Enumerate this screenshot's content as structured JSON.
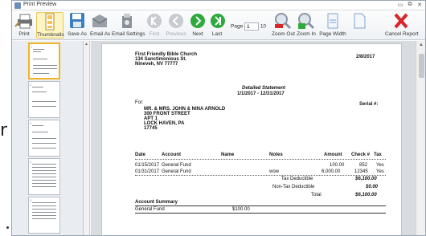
{
  "window": {
    "title": "Print Preview",
    "controls": [
      "▭",
      "⧉",
      "✕"
    ]
  },
  "backdrop": {
    "glyph": "r"
  },
  "toolbar": {
    "buttons": [
      {
        "label": "Print",
        "icon": "printer-icon"
      },
      {
        "label": "Thumbnails",
        "icon": "thumbnails-icon"
      },
      {
        "label": "Save As",
        "icon": "save-icon"
      },
      {
        "label": "Email As",
        "icon": "email-icon"
      },
      {
        "label": "Email Settings",
        "icon": "email-settings-icon"
      },
      {
        "label": "First",
        "icon": "first-page-icon"
      },
      {
        "label": "Previous",
        "icon": "previous-page-icon"
      },
      {
        "label": "Next",
        "icon": "next-page-icon"
      },
      {
        "label": "Last",
        "icon": "last-page-icon"
      },
      {
        "label": "Zoom Out",
        "icon": "zoom-out-icon"
      },
      {
        "label": "Zoom In",
        "icon": "zoom-in-icon"
      },
      {
        "label": "Page Width",
        "icon": "page-width-icon"
      },
      {
        "label": "",
        "icon": "page-icon"
      },
      {
        "label": "Cancel Report",
        "icon": "cancel-icon"
      }
    ],
    "page_label": "Page",
    "page_value": "1",
    "page_total": "10"
  },
  "thumbnails": {
    "numbers": [
      "1",
      "2",
      "3",
      "4",
      "5"
    ]
  },
  "report": {
    "church_name": "First Friendly Bible Church",
    "church_address1": "134 Sanctimonious St.",
    "church_address2": "Nineveh, NV 77777",
    "print_date": "2/8/2017",
    "statement_title": "Detailed Statement",
    "statement_range": "1/1/2017 - 12/31/2017",
    "for_label": "For:",
    "serial_label": "Serial #:",
    "recipient": [
      "MR. & MRS. JOHN & NINA ARNOLD",
      "300 FRONT STREET",
      "APT 1",
      "LOCK HAVEN, PA",
      "17745"
    ],
    "columns": {
      "date": "Date",
      "account": "Account",
      "name": "Name",
      "notes": "Notes",
      "amount": "Amount",
      "check": "Check #",
      "tax": "Tax"
    },
    "rows": [
      {
        "date": "01/15/2017",
        "account": "General Fund",
        "name": "",
        "notes": "",
        "amount": "100.00",
        "check": "852",
        "tax": "Yes"
      },
      {
        "date": "01/31/2017",
        "account": "General Fund",
        "name": "",
        "notes": "wow",
        "amount": "6,000.00",
        "check": "12345",
        "tax": "Yes"
      }
    ],
    "totals": [
      {
        "label": "Tax Deductible",
        "value": "$6,100.00"
      },
      {
        "label": "Non-Tax Deductible",
        "value": "$0.00"
      },
      {
        "label": "Total",
        "value": "$6,100.00"
      }
    ],
    "summary_title": "Account Summary",
    "summary_rows": [
      {
        "account": "General Fund",
        "amount": "$100.00"
      }
    ]
  },
  "colors": {
    "accent_selected": "#f0b429",
    "cancel_red": "#d9262b",
    "nav_green": "#2eaa3c"
  }
}
